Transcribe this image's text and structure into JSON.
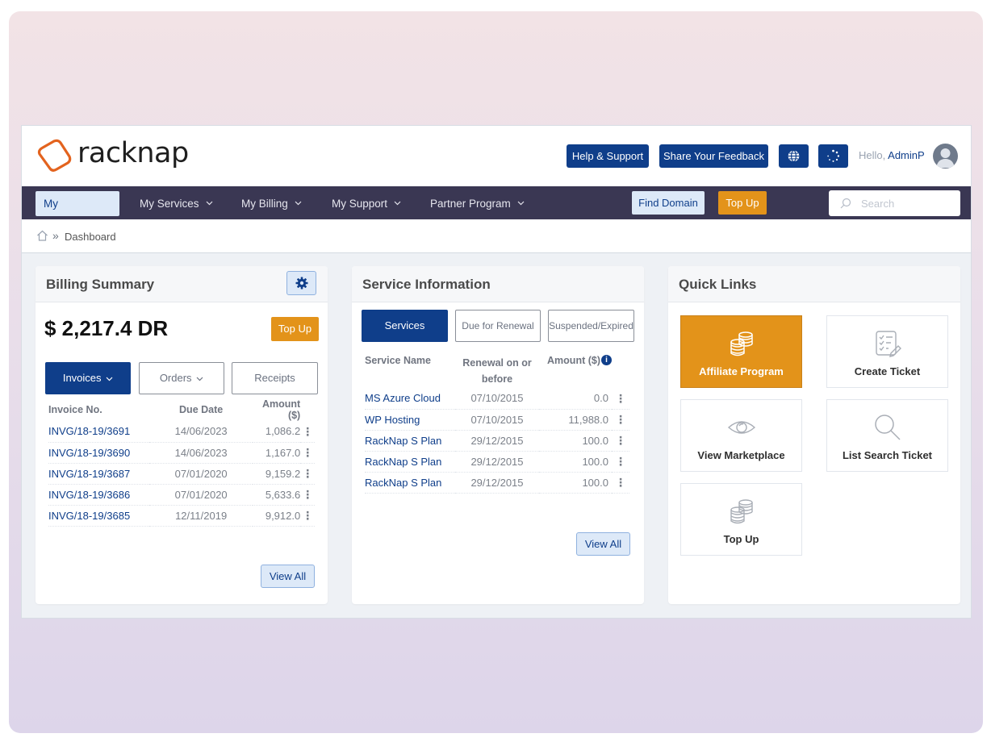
{
  "brand": {
    "name": "racknap",
    "logo_color": "#e3631e"
  },
  "header": {
    "help_label": "Help & Support",
    "feedback_label": "Share Your Feedback",
    "globe_icon": "globe-icon",
    "loader_icon": "spinner-icon",
    "greeting": "Hello,",
    "username": "AdminP"
  },
  "nav": {
    "items": [
      {
        "label": "My Dashboard",
        "active": true
      },
      {
        "label": "My Services"
      },
      {
        "label": "My Billing"
      },
      {
        "label": "My Support"
      },
      {
        "label": "Partner Program"
      }
    ],
    "find_domain": "Find Domain",
    "top_up": "Top Up",
    "search_placeholder": "Search"
  },
  "breadcrumb": {
    "current": "Dashboard"
  },
  "billing": {
    "title": "Billing Summary",
    "balance": "$ 2,217.4 DR",
    "top_up": "Top Up",
    "tabs": [
      "Invoices",
      "Orders",
      "Receipts"
    ],
    "columns": [
      "Invoice No.",
      "Due Date",
      "Amount ($)"
    ],
    "rows": [
      {
        "invoice": "INVG/18-19/3691",
        "due": "14/06/2023",
        "amount": "1,086.2"
      },
      {
        "invoice": "INVG/18-19/3690",
        "due": "14/06/2023",
        "amount": "1,167.0"
      },
      {
        "invoice": "INVG/18-19/3687",
        "due": "07/01/2020",
        "amount": "9,159.2"
      },
      {
        "invoice": "INVG/18-19/3686",
        "due": "07/01/2020",
        "amount": "5,633.6"
      },
      {
        "invoice": "INVG/18-19/3685",
        "due": "12/11/2019",
        "amount": "9,912.0"
      }
    ],
    "view_all": "View All"
  },
  "services": {
    "title": "Service Information",
    "tabs": [
      "Services",
      "Due for Renewal",
      "Suspended/Expired"
    ],
    "columns": [
      "Service Name",
      "Renewal on or before",
      "Amount ($)"
    ],
    "rows": [
      {
        "name": "MS Azure Cloud",
        "renewal": "07/10/2015",
        "amount": "0.0"
      },
      {
        "name": "WP Hosting",
        "renewal": "07/10/2015",
        "amount": "11,988.0"
      },
      {
        "name": "RackNap S Plan",
        "renewal": "29/12/2015",
        "amount": "100.0"
      },
      {
        "name": "RackNap S Plan",
        "renewal": "29/12/2015",
        "amount": "100.0"
      },
      {
        "name": "RackNap S Plan",
        "renewal": "29/12/2015",
        "amount": "100.0"
      }
    ],
    "view_all": "View All"
  },
  "quick_links": {
    "title": "Quick Links",
    "items": [
      {
        "label": "Affiliate Program",
        "icon": "coins-icon",
        "highlight": true
      },
      {
        "label": "Create Ticket",
        "icon": "checklist-icon"
      },
      {
        "label": "View Marketplace",
        "icon": "eye-icon"
      },
      {
        "label": "List Search Ticket",
        "icon": "magnifier-icon"
      },
      {
        "label": "Top Up",
        "icon": "coins-icon"
      }
    ]
  },
  "colors": {
    "primary": "#0f3e8a",
    "accent": "#e3931a",
    "nav_bg": "#3a3753"
  }
}
